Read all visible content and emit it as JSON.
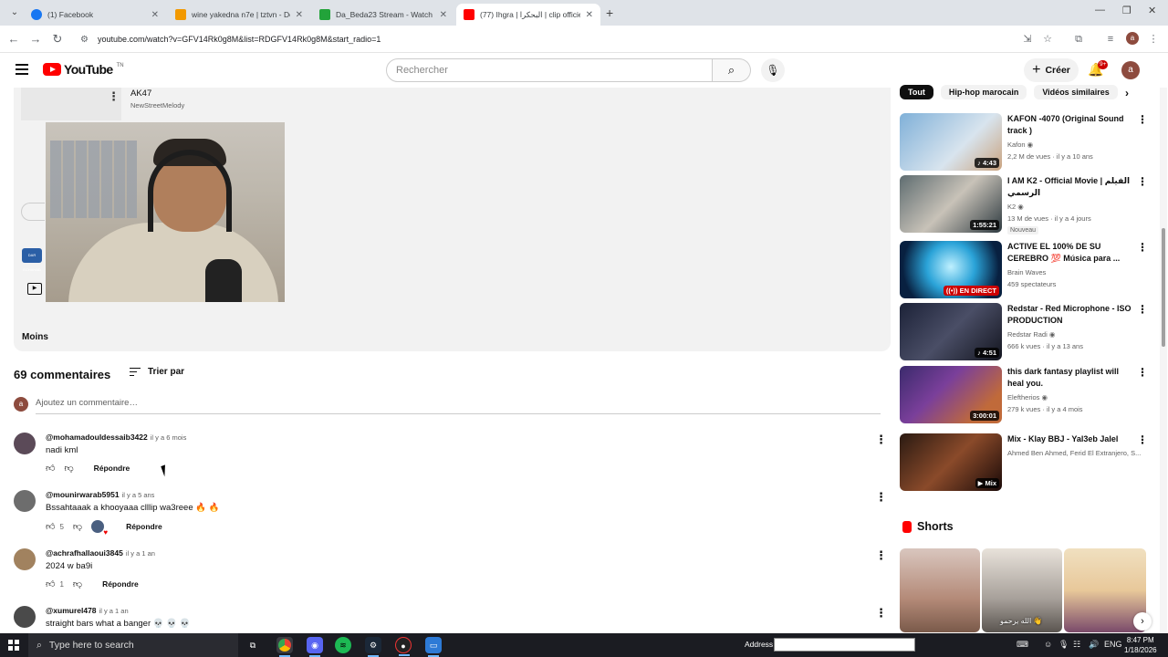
{
  "browser": {
    "tabs": [
      {
        "label": "(1) Facebook",
        "color": "#1877f2"
      },
      {
        "label": "wine yakedna n7e | tztvn - Doc",
        "color": "#f29900"
      },
      {
        "label": "Da_Beda23 Stream - Watch Live",
        "color": "#22a33a"
      },
      {
        "label": "(77) Ihgra | البحكرا | clip officiel vid",
        "color": "#ff0000"
      }
    ],
    "url": "youtube.com/watch?v=GFV14Rk0g8M&list=RDGFV14Rk0g8M&start_radio=1",
    "profile_initial": "a"
  },
  "header": {
    "logo_text": "YouTube",
    "logo_tm": "TN",
    "search_placeholder": "Rechercher",
    "create_label": "Créer",
    "notif_badge": "9+",
    "avatar_initial": "a"
  },
  "description": {
    "song_title": "AK47",
    "song_artist": "NewStreetMelody",
    "channel_badge_text": "DAR ECHAHAD",
    "less_label": "Moins"
  },
  "comments_section": {
    "count_label": "69 commentaires",
    "sort_label": "Trier par",
    "my_initial": "a",
    "add_placeholder": "Ajoutez un commentaire…",
    "reply_label": "Répondre",
    "items": [
      {
        "author": "@mohamadouldessaib3422",
        "time": "il y a 6 mois",
        "text": "nadi kml",
        "likes": "",
        "avatar_color": "#5b4a58"
      },
      {
        "author": "@mounirwarab5951",
        "time": "il y a 5 ans",
        "text": "Bssahtaaak a khooyaaa clllip wa3reee 🔥 🔥",
        "likes": "5",
        "avatar_color": "#6d6d6d"
      },
      {
        "author": "@achrafhallaoui3845",
        "time": "il y a 1 an",
        "text": "2024 w ba9i",
        "likes": "1",
        "avatar_color": "#a1825f"
      },
      {
        "author": "@xumurel478",
        "time": "il y a 1 an",
        "text": "straight bars what a banger 💀 💀 💀",
        "likes": "",
        "avatar_color": "#4a4a4a"
      }
    ]
  },
  "sidebar": {
    "chips": [
      "Tout",
      "Hip-hop marocain",
      "Vidéos similaires"
    ],
    "recommendations": [
      {
        "title": "KAFON -4070 (Original Sound track )",
        "channel": "Kafon ◉",
        "meta": "2,2 M de vues · il y a 10 ans",
        "badge": "",
        "duration": "♪ 4:43",
        "live": false,
        "thumb": "linear-gradient(135deg,#7fb0d8,#d8e4ee 60%,#c9a27e)"
      },
      {
        "title": "I AM K2 - Official Movie | الفيلم الرسمي",
        "channel": "K2 ◉",
        "meta": "13 M de vues · il y a 4 jours",
        "badge": "Nouveau",
        "duration": "1:55:21",
        "live": false,
        "thumb": "linear-gradient(135deg,#5e6c70,#c8c2b8 50%,#2e3a40)"
      },
      {
        "title": "ACTIVE EL 100% DE SU CEREBRO 💯 Música para ...",
        "channel": "Brain Waves",
        "meta": "459 spectateurs",
        "badge": "",
        "duration": "((•)) EN DIRECT",
        "live": true,
        "thumb": "radial-gradient(circle at 50% 45%,#bff0ff,#2aa3d8 40%,#082040 80%)"
      },
      {
        "title": "Redstar - Red Microphone - ISO PRODUCTION",
        "channel": "Redstar Radi ◉",
        "meta": "666 k vues · il y a 13 ans",
        "badge": "",
        "duration": "♪ 4:51",
        "live": false,
        "thumb": "linear-gradient(135deg,#1c2238,#4a4e66 50%,#13151f)"
      },
      {
        "title": "this dark fantasy playlist will heal you.",
        "channel": "Eleftherios ◉",
        "meta": "279 k vues · il y a 4 mois",
        "badge": "",
        "duration": "3:00:01",
        "live": false,
        "thumb": "linear-gradient(135deg,#3a2a6c,#7a3f9a 40%,#c06a3a 80%)"
      },
      {
        "title": "Mix - Klay BBJ - Yal3eb Jalel",
        "channel": "Ahmed Ben Ahmed, Ferid El Extranjero, S...",
        "meta": "",
        "badge": "",
        "duration": "▶ Mix",
        "live": false,
        "thumb": "linear-gradient(135deg,#2a1a12,#8a4a2a 50%,#1a0a08)"
      }
    ],
    "shorts_label": "Shorts",
    "shorts": [
      {
        "thumb": "linear-gradient(180deg,#d9c6be,#b48a78 60%,#7a5a4a)"
      },
      {
        "thumb": "linear-gradient(180deg,#e8e2da,#a7a09a 60%,#5a5550)",
        "caption": "الله يرحمو 👋"
      },
      {
        "thumb": "linear-gradient(180deg,#f0e0c0,#e8c89a 50%,#7a4a6a)"
      }
    ]
  },
  "taskbar": {
    "search_placeholder": "Type here to search",
    "address_label": "Address",
    "lang": "ENG",
    "time": "8:47 PM",
    "date": "1/18/2026"
  }
}
